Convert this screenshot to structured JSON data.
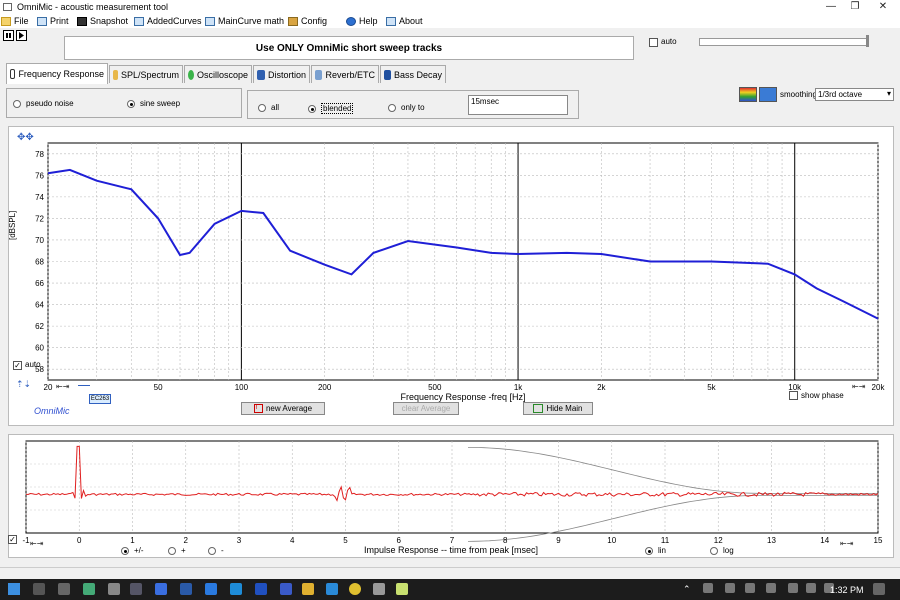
{
  "window": {
    "title": "OmniMic - acoustic measurement tool"
  },
  "menu": [
    {
      "label": "File"
    },
    {
      "label": "Print"
    },
    {
      "label": "Snapshot"
    },
    {
      "label": "AddedCurves"
    },
    {
      "label": "MainCurve math"
    },
    {
      "label": "Config"
    },
    {
      "label": "Help"
    },
    {
      "label": "About"
    }
  ],
  "banner": "Use ONLY OmniMic short sweep tracks",
  "auto_label": "auto",
  "tabs": [
    {
      "label": "Frequency Response"
    },
    {
      "label": "SPL/Spectrum"
    },
    {
      "label": "Oscilloscope"
    },
    {
      "label": "Distortion"
    },
    {
      "label": "Reverb/ETC"
    },
    {
      "label": "Bass Decay"
    }
  ],
  "source": {
    "pseudo_noise": "pseudo noise",
    "sine_sweep": "sine sweep"
  },
  "gate": {
    "all": "all",
    "blended": "blended",
    "only_to": "only to",
    "value": "15msec"
  },
  "smoothing": {
    "label": "smoothing",
    "value": "1/3rd octave"
  },
  "fr_chart": {
    "ylabel": "[dBSPL]",
    "xlabel": "Frequency Response -freq [Hz]",
    "auto": "auto",
    "show_phase": "show phase",
    "brand": "OmniMic",
    "ec_tag": "EC263",
    "btn_new_average": "new Average",
    "btn_clear_average": "clear Average",
    "btn_hide_main": "Hide Main",
    "y_ticks": [
      "78",
      "76",
      "74",
      "72",
      "70",
      "68",
      "66",
      "64",
      "62",
      "60",
      "58"
    ],
    "x_ticks": [
      "20",
      "50",
      "100",
      "200",
      "500",
      "1k",
      "2k",
      "5k",
      "10k",
      "20k"
    ]
  },
  "chart_data": [
    {
      "type": "line",
      "title": "",
      "xlabel": "Frequency Response -freq [Hz]",
      "ylabel": "[dBSPL]",
      "xscale": "log",
      "xlim": [
        20,
        20000
      ],
      "ylim": [
        57,
        79
      ],
      "grid": true,
      "series": [
        {
          "color": "#1f1fd6",
          "x": [
            20,
            24,
            30,
            40,
            50,
            60,
            65,
            80,
            100,
            120,
            150,
            200,
            250,
            300,
            400,
            600,
            800,
            1000,
            1500,
            2000,
            3000,
            5000,
            8000,
            10000,
            12000,
            15000,
            20000
          ],
          "y": [
            76.2,
            76.5,
            75.5,
            74.7,
            72.0,
            68.6,
            68.8,
            71.5,
            72.7,
            72.5,
            69.0,
            67.7,
            66.8,
            68.8,
            69.9,
            69.3,
            68.8,
            68.7,
            68.8,
            68.7,
            68.0,
            68.0,
            67.8,
            66.8,
            65.5,
            64.3,
            62.7
          ]
        }
      ]
    },
    {
      "type": "line",
      "title": "",
      "xlabel": "Impulse Response -- time from peak [msec]",
      "ylabel": "",
      "xlim": [
        -1,
        15
      ],
      "grid": true,
      "series": [
        {
          "color": "#e02020",
          "note_peak_at": 0
        }
      ]
    }
  ],
  "ir_chart": {
    "xlabel": "Impulse Response -- time from peak [msec]",
    "x_ticks": [
      "-1",
      "0",
      "1",
      "2",
      "3",
      "4",
      "5",
      "6",
      "7",
      "8",
      "9",
      "10",
      "11",
      "12",
      "13",
      "14",
      "15"
    ],
    "polarity": {
      "plus_minus": "+/-",
      "plus": "+",
      "minus": "-"
    },
    "scale": {
      "lin": "lin",
      "log": "log"
    }
  },
  "taskbar": {
    "time": "1:32 PM"
  }
}
